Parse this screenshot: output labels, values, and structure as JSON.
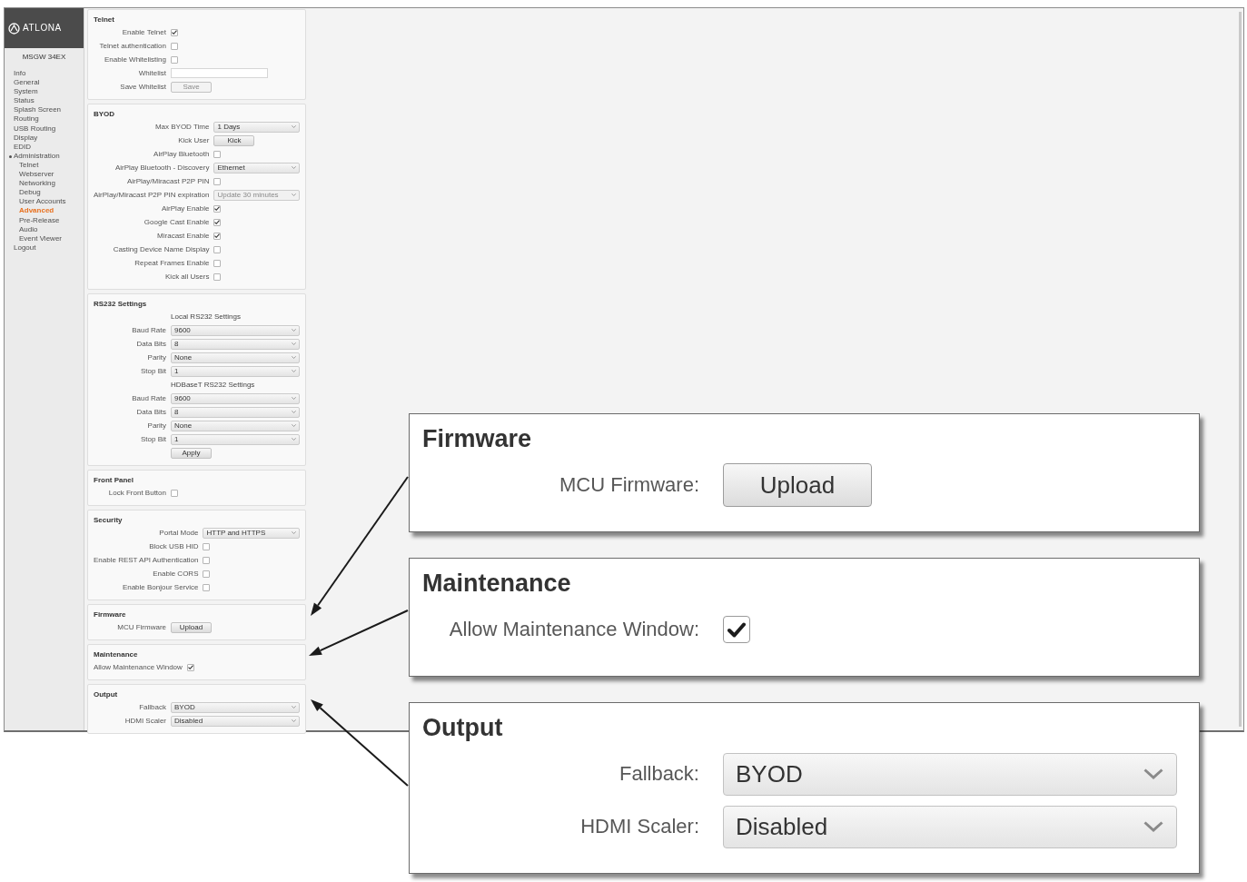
{
  "logo": "ATLONA",
  "sidebar": {
    "device_name": "MSGW 34EX",
    "items": [
      {
        "label": "Info",
        "selected": false
      },
      {
        "label": "General",
        "selected": false
      },
      {
        "label": "System",
        "selected": false
      },
      {
        "label": "Status",
        "selected": false
      },
      {
        "label": "Splash Screen",
        "selected": false
      },
      {
        "label": "Routing",
        "selected": false
      },
      {
        "label": "USB Routing",
        "selected": false
      },
      {
        "label": "Display",
        "selected": false
      },
      {
        "label": "EDID",
        "selected": false
      },
      {
        "label": "Administration",
        "selected": false,
        "expanded": true,
        "children": [
          {
            "label": "Telnet",
            "selected": false
          },
          {
            "label": "Webserver",
            "selected": false
          },
          {
            "label": "Networking",
            "selected": false
          },
          {
            "label": "Debug",
            "selected": false
          },
          {
            "label": "User Accounts",
            "selected": false
          },
          {
            "label": "Advanced",
            "selected": true
          },
          {
            "label": "Pre-Release",
            "selected": false
          },
          {
            "label": "Audio",
            "selected": false
          },
          {
            "label": "Event Viewer",
            "selected": false
          }
        ]
      },
      {
        "label": "Logout",
        "selected": false
      }
    ]
  },
  "sections": [
    {
      "title": "Telnet",
      "rows": [
        {
          "kind": "checkbox",
          "label": "Enable Telnet",
          "checked": true
        },
        {
          "kind": "checkbox",
          "label": "Telnet authentication",
          "checked": false
        },
        {
          "kind": "checkbox",
          "label": "Enable Whitelisting",
          "checked": false
        },
        {
          "kind": "input",
          "label": "Whitelist"
        },
        {
          "kind": "button",
          "label": "Save Whitelist",
          "button": "Save",
          "disabled": true
        }
      ]
    },
    {
      "title": "BYOD",
      "rows": [
        {
          "kind": "select",
          "label": "Max BYOD Time",
          "value": "1 Days",
          "disabled": false
        },
        {
          "kind": "button",
          "label": "Kick User",
          "button": "Kick",
          "disabled": false
        },
        {
          "kind": "checkbox",
          "label": "AirPlay Bluetooth",
          "checked": false
        },
        {
          "kind": "select",
          "label": "AirPlay Bluetooth - Discovery",
          "value": "Ethernet",
          "disabled": false
        },
        {
          "kind": "checkbox",
          "label": "AirPlay/Miracast P2P PIN",
          "checked": false
        },
        {
          "kind": "select",
          "label": "AirPlay/Miracast P2P PIN expiration",
          "value": "Update 30 minutes",
          "disabled": true
        },
        {
          "kind": "checkbox",
          "label": "AirPlay Enable",
          "checked": true
        },
        {
          "kind": "checkbox",
          "label": "Google Cast Enable",
          "checked": true
        },
        {
          "kind": "checkbox",
          "label": "Miracast Enable",
          "checked": true
        },
        {
          "kind": "checkbox",
          "label": "Casting Device Name Display",
          "checked": false
        },
        {
          "kind": "checkbox",
          "label": "Repeat Frames Enable",
          "checked": false
        },
        {
          "kind": "checkbox",
          "label": "Kick all Users",
          "checked": false
        }
      ]
    },
    {
      "title": "RS232 Settings",
      "rows": [
        {
          "kind": "heading",
          "label": "Local RS232 Settings"
        },
        {
          "kind": "select",
          "label": "Baud Rate",
          "value": "9600",
          "disabled": false
        },
        {
          "kind": "select",
          "label": "Data Bits",
          "value": "8",
          "disabled": false
        },
        {
          "kind": "select",
          "label": "Parity",
          "value": "None",
          "disabled": false
        },
        {
          "kind": "select",
          "label": "Stop Bit",
          "value": "1",
          "disabled": false
        },
        {
          "kind": "heading",
          "label": "HDBaseT RS232 Settings"
        },
        {
          "kind": "select",
          "label": "Baud Rate",
          "value": "9600",
          "disabled": false
        },
        {
          "kind": "select",
          "label": "Data Bits",
          "value": "8",
          "disabled": false
        },
        {
          "kind": "select",
          "label": "Parity",
          "value": "None",
          "disabled": false
        },
        {
          "kind": "select",
          "label": "Stop Bit",
          "value": "1",
          "disabled": false
        },
        {
          "kind": "button",
          "button": "Apply",
          "disabled": false
        }
      ]
    },
    {
      "title": "Front Panel",
      "rows": [
        {
          "kind": "checkbox",
          "label": "Lock Front Button",
          "checked": false
        }
      ]
    },
    {
      "title": "Security",
      "rows": [
        {
          "kind": "select",
          "label": "Portal Mode",
          "value": "HTTP and HTTPS",
          "disabled": false
        },
        {
          "kind": "checkbox",
          "label": "Block USB HID",
          "checked": false
        },
        {
          "kind": "checkbox",
          "label": "Enable REST API Authentication",
          "checked": false
        },
        {
          "kind": "checkbox",
          "label": "Enable CORS",
          "checked": false
        },
        {
          "kind": "checkbox",
          "label": "Enable Bonjour Service",
          "checked": false
        }
      ]
    },
    {
      "title": "Firmware",
      "rows": [
        {
          "kind": "button",
          "label": "MCU Firmware",
          "button": "Upload",
          "disabled": false
        }
      ]
    },
    {
      "title": "Maintenance",
      "rows": [
        {
          "kind": "checkbox",
          "label": "Allow Maintenance Window",
          "checked": true
        }
      ]
    },
    {
      "title": "Output",
      "rows": [
        {
          "kind": "select",
          "label": "Fallback",
          "value": "BYOD",
          "disabled": false
        },
        {
          "kind": "select",
          "label": "HDMI Scaler",
          "value": "Disabled",
          "disabled": false
        }
      ]
    }
  ],
  "callouts": [
    {
      "title": "Firmware",
      "rows": [
        {
          "kind": "button",
          "label": "MCU Firmware:",
          "button": "Upload",
          "disabled": false
        }
      ]
    },
    {
      "title": "Maintenance",
      "rows": [
        {
          "kind": "checkbox",
          "label": "Allow Maintenance Window:",
          "checked": true
        }
      ]
    },
    {
      "title": "Output",
      "rows": [
        {
          "kind": "select",
          "label": "Fallback:",
          "value": "BYOD",
          "disabled": false
        },
        {
          "kind": "select",
          "label": "HDMI Scaler:",
          "value": "Disabled",
          "disabled": false
        }
      ]
    }
  ]
}
